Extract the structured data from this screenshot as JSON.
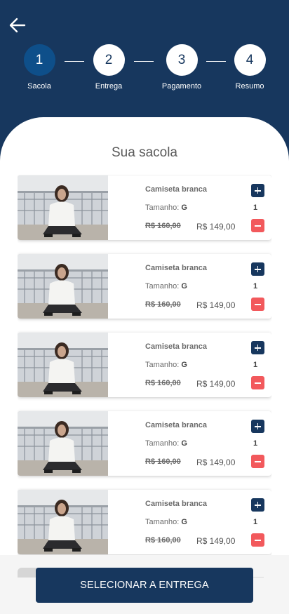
{
  "header": {
    "back_icon": "arrow-left-icon",
    "steps": [
      {
        "number": "1",
        "label": "Sacola",
        "active": true
      },
      {
        "number": "2",
        "label": "Entrega",
        "active": false
      },
      {
        "number": "3",
        "label": "Pagamento",
        "active": false
      },
      {
        "number": "4",
        "label": "Resumo",
        "active": false
      }
    ]
  },
  "main": {
    "title": "Sua sacola",
    "items": [
      {
        "name": "Camiseta branca",
        "size_label": "Tamanho:",
        "size_value": "G",
        "quantity": "1",
        "old_price": "R$ 160,00",
        "price": "R$ 149,00"
      },
      {
        "name": "Camiseta branca",
        "size_label": "Tamanho:",
        "size_value": "G",
        "quantity": "1",
        "old_price": "R$ 160,00",
        "price": "R$ 149,00"
      },
      {
        "name": "Camiseta branca",
        "size_label": "Tamanho:",
        "size_value": "G",
        "quantity": "1",
        "old_price": "R$ 160,00",
        "price": "R$ 149,00"
      },
      {
        "name": "Camiseta branca",
        "size_label": "Tamanho:",
        "size_value": "G",
        "quantity": "1",
        "old_price": "R$ 160,00",
        "price": "R$ 149,00"
      },
      {
        "name": "Camiseta branca",
        "size_label": "Tamanho:",
        "size_value": "G",
        "quantity": "1",
        "old_price": "R$ 160,00",
        "price": "R$ 149,00"
      }
    ]
  },
  "footer": {
    "cta_label": "SELECIONAR A ENTREGA"
  },
  "colors": {
    "primary": "#17375e",
    "active_step": "#0e4f8a",
    "minus": "#f2595c"
  }
}
